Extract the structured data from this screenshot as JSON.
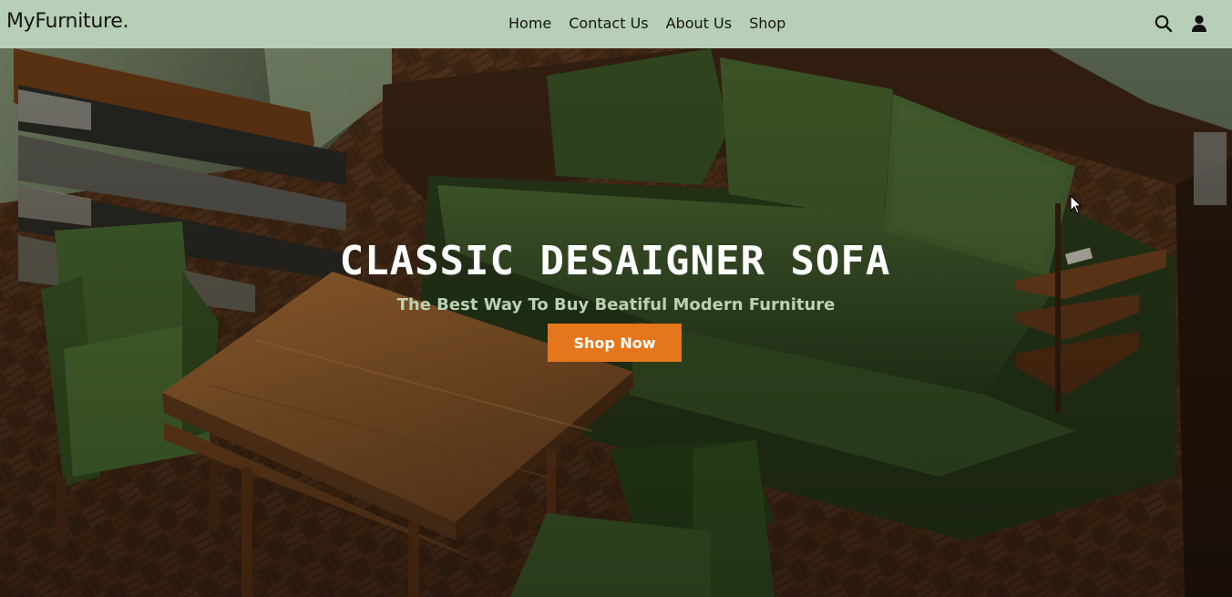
{
  "navbar": {
    "logo": "MyFurniture.",
    "links": [
      "Home",
      "Contact Us",
      "About Us",
      "Shop"
    ],
    "icons": [
      "search-icon",
      "user-icon"
    ],
    "background": "#b7cfb6"
  },
  "hero": {
    "title": "CLASSIC DESAIGNER SOFA",
    "subtitle": "The Best Way To Buy Beatiful Modern Furniture",
    "cta_label": "Shop Now",
    "cta_color": "#e4771d",
    "subtitle_color": "#b9d2b3"
  }
}
